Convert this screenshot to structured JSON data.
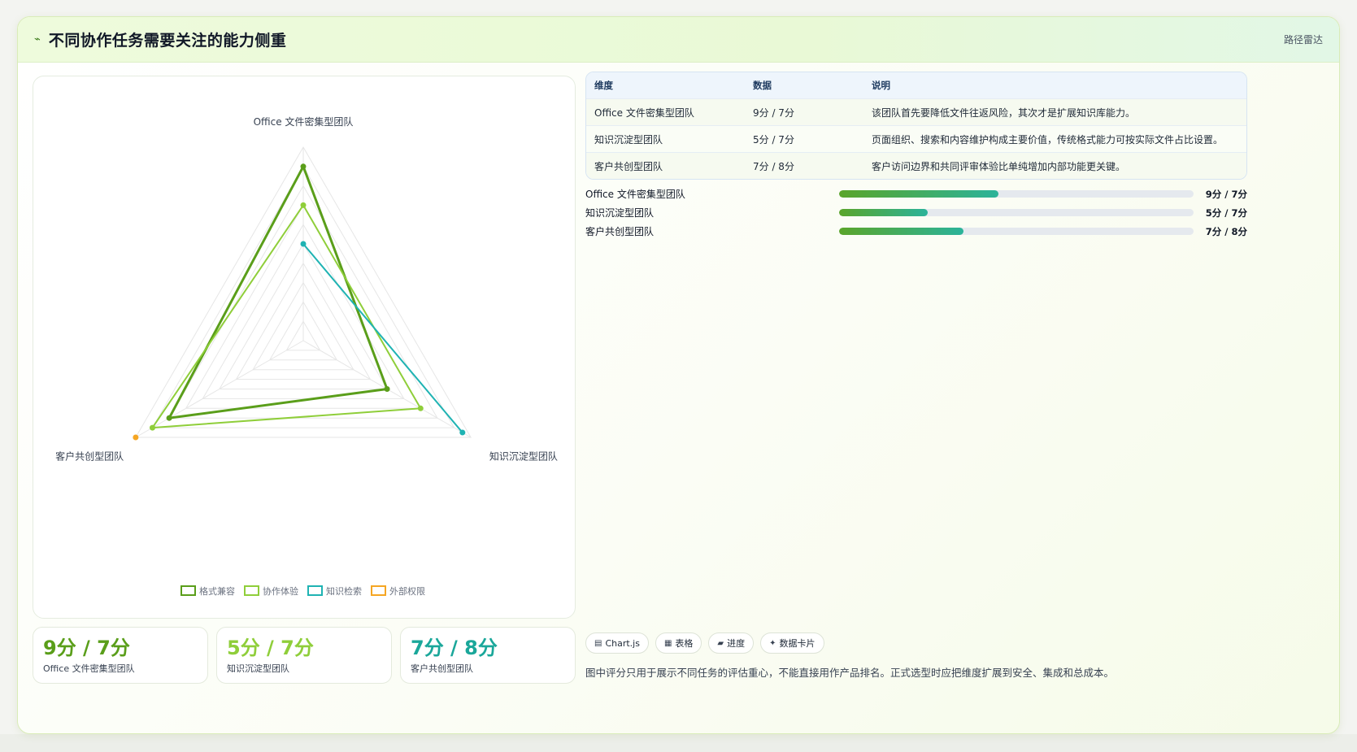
{
  "header": {
    "title_icon": "route-icon",
    "title": "不同协作任务需要关注的能力侧重",
    "tag": "路径雷达"
  },
  "chart_data": {
    "type": "radar",
    "axes": [
      "Office 文件密集型团队",
      "知识沉淀型团队",
      "客户共创型团队"
    ],
    "range": [
      0,
      10
    ],
    "series": [
      {
        "name": "格式兼容",
        "color": "#5a9e1a",
        "values": [
          9,
          5,
          8
        ]
      },
      {
        "name": "协作体验",
        "color": "#8fce3a",
        "values": [
          7,
          7,
          9
        ]
      },
      {
        "name": "知识检索",
        "color": "#1fb3b3",
        "values": [
          5,
          9.5,
          null
        ]
      },
      {
        "name": "外部权限",
        "color": "#f5a623",
        "values": [
          null,
          null,
          10
        ]
      }
    ],
    "legend_position": "bottom"
  },
  "stats": [
    {
      "value": "9分 / 7分",
      "label": "Office 文件密集型团队",
      "color": "#5a9e1a"
    },
    {
      "value": "5分 / 7分",
      "label": "知识沉淀型团队",
      "color": "#8fce3a"
    },
    {
      "value": "7分 / 8分",
      "label": "客户共创型团队",
      "color": "#1aa79a"
    }
  ],
  "table": {
    "headers": [
      "维度",
      "数据",
      "说明"
    ],
    "rows": [
      [
        "Office 文件密集型团队",
        "9分 / 7分",
        "该团队首先要降低文件往返风险，其次才是扩展知识库能力。"
      ],
      [
        "知识沉淀型团队",
        "5分 / 7分",
        "页面组织、搜索和内容维护构成主要价值，传统格式能力可按实际文件占比设置。"
      ],
      [
        "客户共创型团队",
        "7分 / 8分",
        "客户访问边界和共同评审体验比单纯增加内部功能更关键。"
      ]
    ]
  },
  "progress": [
    {
      "label": "Office 文件密集型团队",
      "value": "9分 / 7分",
      "fraction": 0.45
    },
    {
      "label": "知识沉淀型团队",
      "value": "5分 / 7分",
      "fraction": 0.25
    },
    {
      "label": "客户共创型团队",
      "value": "7分 / 8分",
      "fraction": 0.35
    }
  ],
  "chips": [
    {
      "icon": "chart-icon",
      "glyph": "▤",
      "label": "Chart.js"
    },
    {
      "icon": "table-icon",
      "glyph": "▦",
      "label": "表格"
    },
    {
      "icon": "progress-icon",
      "glyph": "▰",
      "label": "进度"
    },
    {
      "icon": "sparkle-icon",
      "glyph": "✦",
      "label": "数据卡片"
    }
  ],
  "footnote": "图中评分只用于展示不同任务的评估重心，不能直接用作产品排名。正式选型时应把维度扩展到安全、集成和总成本。"
}
